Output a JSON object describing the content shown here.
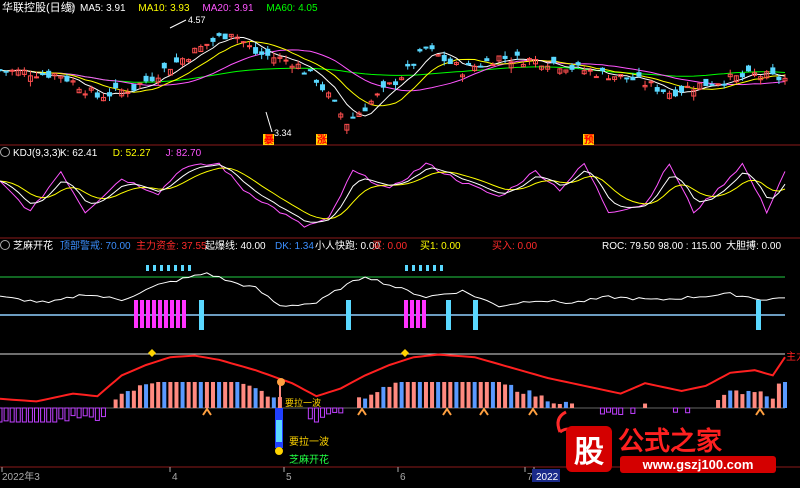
{
  "panels": {
    "main": {
      "title": "华联控股(日线)",
      "ma": [
        {
          "label": "MA5: 3.91",
          "color": "#ffffff"
        },
        {
          "label": "MA10: 3.93",
          "color": "#ffff00"
        },
        {
          "label": "MA20: 3.91",
          "color": "#ff55ff"
        },
        {
          "label": "MA60: 4.05",
          "color": "#00ff00"
        }
      ],
      "high_label": "4.57",
      "low_label": "3.34",
      "tags": [
        {
          "text": "暴",
          "color": "#ff0000",
          "bg": "#ffd400"
        },
        {
          "text": "涨",
          "color": "#ff0000",
          "bg": "#ffd400"
        },
        {
          "text": "预",
          "color": "#ff0000",
          "bg": "#ffd400"
        }
      ]
    },
    "kdj": {
      "title": "KDJ(9,3,3)",
      "values": [
        {
          "label": "K: 62.41",
          "color": "#ffffff"
        },
        {
          "label": "D: 52.27",
          "color": "#ffff00"
        },
        {
          "label": "J: 82.70",
          "color": "#ff55ff"
        }
      ]
    },
    "indicator": {
      "title": "芝麻开花",
      "values": [
        {
          "label": "顶部警戒: 70.00",
          "color": "#3b8fff"
        },
        {
          "label": "主力资金: 37.55",
          "color": "#ff2a2a"
        },
        {
          "label": "起爆线: 40.00",
          "color": "#ffffff"
        },
        {
          "label": "DK: 1.34",
          "color": "#3b8fff"
        },
        {
          "label": "小人快跑: 0.00",
          "color": "#ffffff"
        },
        {
          "label": "买: 0.00",
          "color": "#ff2a2a"
        },
        {
          "label": "买1: 0.00",
          "color": "#ffff00"
        },
        {
          "label": "买入: 0.00",
          "color": "#ff2a2a"
        },
        {
          "label": "ROC: 79.50",
          "color": "#ffffff"
        },
        {
          "label": "98.00 : 115.00",
          "color": "#ffffff"
        },
        {
          "label": "大胆搏: 0.00",
          "color": "#ffffff"
        }
      ],
      "annotations": [
        "要拉一波",
        "芝麻开花",
        "要拉一波"
      ],
      "line_tag": "主力"
    }
  },
  "xaxis": {
    "labels": [
      "2022年3",
      "4",
      "5",
      "6",
      "7",
      "2022"
    ]
  },
  "logo": {
    "char": "股",
    "name": "公式之家",
    "url": "www.gszj100.com"
  },
  "colors": {
    "bg": "#000000",
    "border": "#8b1a1a",
    "up": "#ff4f4f",
    "down": "#5ad8ff",
    "ma5": "#ffffff",
    "ma10": "#ffff00",
    "ma20": "#ff55ff",
    "ma60": "#00ff00"
  }
}
